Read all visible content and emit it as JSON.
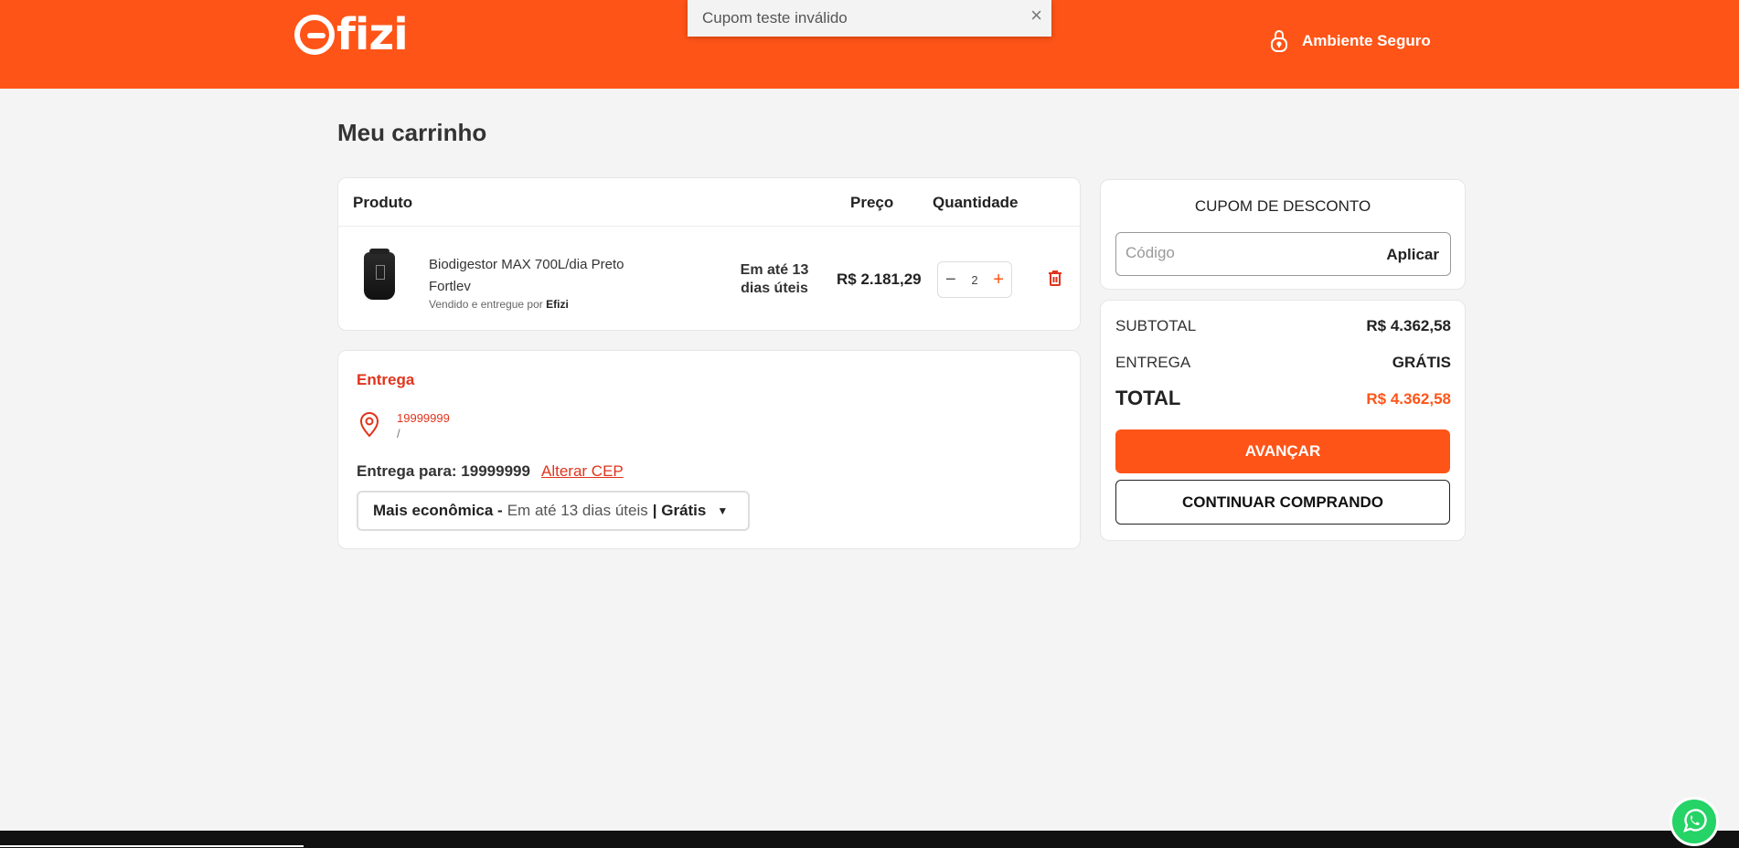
{
  "header": {
    "logo_text": "fizi",
    "secure_label": "Ambiente Seguro",
    "bg_color": "#ff5417"
  },
  "toast": {
    "message": "Cupom teste inválido",
    "close_icon": "×"
  },
  "page": {
    "title": "Meu carrinho"
  },
  "cart": {
    "headers": {
      "product": "Produto",
      "price": "Preço",
      "quantity": "Quantidade"
    },
    "items": [
      {
        "name": "Biodigestor MAX 700L/dia Preto Fortlev",
        "seller_prefix": "Vendido e entregue por",
        "seller": "Efizi",
        "delivery_time": "Em até 13 dias úteis",
        "price": "R$ 2.181,29",
        "quantity": "2",
        "minus_symbol": "−",
        "plus_symbol": "+"
      }
    ]
  },
  "shipping": {
    "title": "Entrega",
    "cep": "19999999",
    "address": "/",
    "ship_to_label": "Entrega para: 19999999",
    "change_cep": "Alterar CEP",
    "option": {
      "name": "Mais econômica -",
      "time": "Em até 13 dias úteis",
      "price": "| Grátis",
      "chevron": "⌄"
    }
  },
  "coupon": {
    "title": "CUPOM DE DESCONTO",
    "placeholder": "Código",
    "apply": "Aplicar"
  },
  "summary": {
    "subtotal_label": "SUBTOTAL",
    "subtotal_value": "R$ 4.362,58",
    "shipping_label": "ENTREGA",
    "shipping_value": "GRÁTIS",
    "total_label": "TOTAL",
    "total_value": "R$ 4.362,58",
    "next_button": "AVANÇAR",
    "continue_button": "CONTINUAR COMPRANDO"
  },
  "accent_color": "#ff5417",
  "icons": [
    "lock-icon",
    "close-icon",
    "trash-icon",
    "location-pin-icon",
    "chevron-down-icon",
    "whatsapp-icon"
  ]
}
